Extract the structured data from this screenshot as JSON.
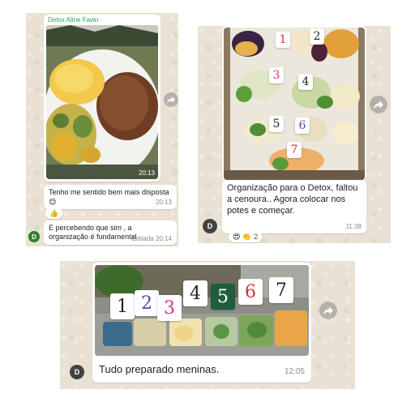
{
  "colors": {
    "sender_name": "#1fa855",
    "avatar_green": "#2e7d32",
    "avatar_dark": "#424242",
    "tag_red": "#d0343a",
    "tag_pink": "#d2387e",
    "tag_blue": "#4a4ab4",
    "tag_dark": "#222222",
    "tag_green_bg": "#1e5e3c"
  },
  "chat1": {
    "sender_name": "Detox Aline Favin",
    "photo_time": "20:13",
    "message1": {
      "text": "Tenho me sentido bem mais disposta",
      "emoji": "😊",
      "time": "20:13"
    },
    "reaction1": {
      "emoji": "👍"
    },
    "message2": {
      "text": "E percebendo que sim , a organização é fundamental",
      "time": "Editada 20:14"
    },
    "avatar_initial": "D",
    "forward_icon": "forward-arrow-icon"
  },
  "chat2": {
    "number_tags": [
      "1",
      "2",
      "3",
      "4",
      "5",
      "6",
      "7"
    ],
    "message": {
      "text": "Organização para o Detox, faltou a cenoura.. Agora colocar nos potes e começar.",
      "time": "11:38"
    },
    "reactions": {
      "emojis": "😍 👏",
      "count": "2"
    },
    "avatar_initial": "D",
    "forward_icon": "forward-arrow-icon"
  },
  "chat3": {
    "number_tags": [
      "1",
      "2",
      "3",
      "4",
      "5",
      "6",
      "7"
    ],
    "message": {
      "text": "Tudo preparado meninas.",
      "time": "12:05"
    },
    "avatar_initial": "D",
    "forward_icon": "forward-arrow-icon"
  }
}
